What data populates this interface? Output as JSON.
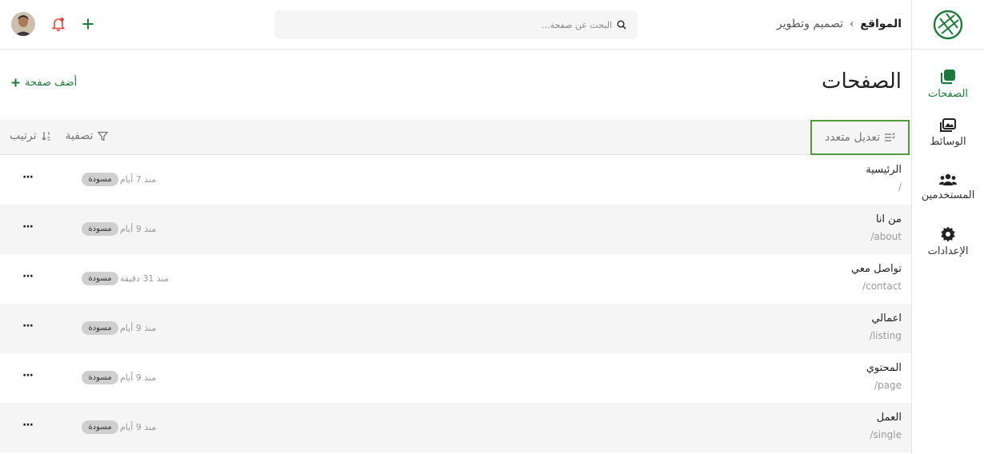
{
  "header": {
    "breadcrumb_root": "المواقع",
    "breadcrumb_separator": "›",
    "breadcrumb_current": "تصميم وتطوير",
    "search_placeholder": "البحث عن صفحة..."
  },
  "sidebar": {
    "items": [
      {
        "label": "الصفحات",
        "icon": "pages-icon"
      },
      {
        "label": "الوسائط",
        "icon": "media-icon"
      },
      {
        "label": "المستخدمين",
        "icon": "users-icon"
      },
      {
        "label": "الإعدادات",
        "icon": "gear-icon"
      }
    ]
  },
  "main": {
    "title": "الصفحات",
    "add_page_label": "أضف صفحة",
    "bulk_edit_label": "تعديل متعدد",
    "filter_label": "تصفية",
    "sort_label": "ترتيب"
  },
  "pages": [
    {
      "title": "الرئيسية",
      "slug": "/",
      "time": "منذ 7 أيام",
      "status": "مسودة"
    },
    {
      "title": "من انا",
      "slug": "/about",
      "time": "منذ 9 أيام",
      "status": "مسودة"
    },
    {
      "title": "تواصل معي",
      "slug": "/contact",
      "time": "منذ 31 دقيقة",
      "status": "مسودة"
    },
    {
      "title": "اعمالي",
      "slug": "/listing",
      "time": "منذ 9 أيام",
      "status": "مسودة"
    },
    {
      "title": "المحتوي",
      "slug": "/page",
      "time": "منذ 9 أيام",
      "status": "مسودة"
    },
    {
      "title": "العمل",
      "slug": "/single",
      "time": "منذ 9 أيام",
      "status": "مسودة"
    }
  ],
  "colors": {
    "accent": "#1e7a3c",
    "notification": "#e0443c",
    "highlight_border": "#4f9a3a"
  }
}
